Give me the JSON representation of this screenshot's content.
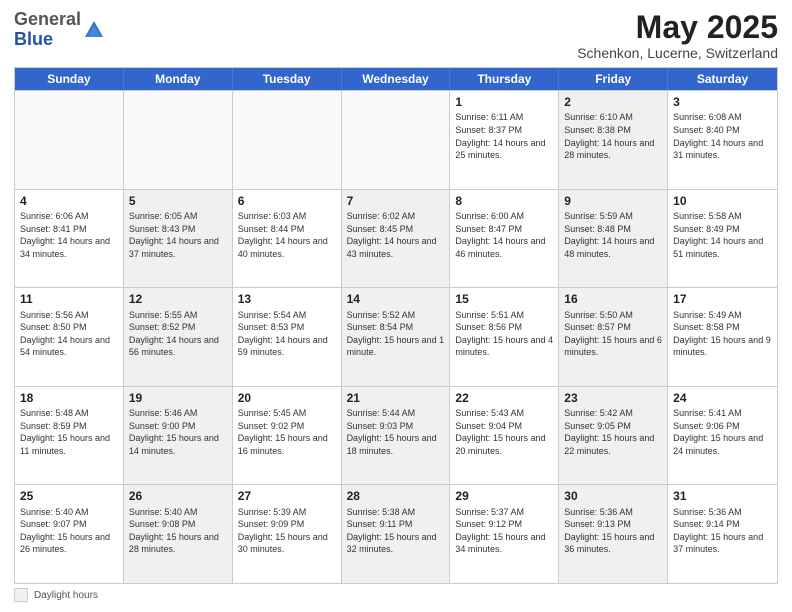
{
  "logo": {
    "general": "General",
    "blue": "Blue"
  },
  "title": "May 2025",
  "subtitle": "Schenkon, Lucerne, Switzerland",
  "weekdays": [
    "Sunday",
    "Monday",
    "Tuesday",
    "Wednesday",
    "Thursday",
    "Friday",
    "Saturday"
  ],
  "weeks": [
    [
      {
        "day": "",
        "info": "",
        "empty": true
      },
      {
        "day": "",
        "info": "",
        "empty": true
      },
      {
        "day": "",
        "info": "",
        "empty": true
      },
      {
        "day": "",
        "info": "",
        "empty": true
      },
      {
        "day": "1",
        "info": "Sunrise: 6:11 AM\nSunset: 8:37 PM\nDaylight: 14 hours and 25 minutes.",
        "empty": false,
        "shaded": false
      },
      {
        "day": "2",
        "info": "Sunrise: 6:10 AM\nSunset: 8:38 PM\nDaylight: 14 hours and 28 minutes.",
        "empty": false,
        "shaded": true
      },
      {
        "day": "3",
        "info": "Sunrise: 6:08 AM\nSunset: 8:40 PM\nDaylight: 14 hours and 31 minutes.",
        "empty": false,
        "shaded": false
      }
    ],
    [
      {
        "day": "4",
        "info": "Sunrise: 6:06 AM\nSunset: 8:41 PM\nDaylight: 14 hours and 34 minutes.",
        "empty": false,
        "shaded": false
      },
      {
        "day": "5",
        "info": "Sunrise: 6:05 AM\nSunset: 8:43 PM\nDaylight: 14 hours and 37 minutes.",
        "empty": false,
        "shaded": true
      },
      {
        "day": "6",
        "info": "Sunrise: 6:03 AM\nSunset: 8:44 PM\nDaylight: 14 hours and 40 minutes.",
        "empty": false,
        "shaded": false
      },
      {
        "day": "7",
        "info": "Sunrise: 6:02 AM\nSunset: 8:45 PM\nDaylight: 14 hours and 43 minutes.",
        "empty": false,
        "shaded": true
      },
      {
        "day": "8",
        "info": "Sunrise: 6:00 AM\nSunset: 8:47 PM\nDaylight: 14 hours and 46 minutes.",
        "empty": false,
        "shaded": false
      },
      {
        "day": "9",
        "info": "Sunrise: 5:59 AM\nSunset: 8:48 PM\nDaylight: 14 hours and 48 minutes.",
        "empty": false,
        "shaded": true
      },
      {
        "day": "10",
        "info": "Sunrise: 5:58 AM\nSunset: 8:49 PM\nDaylight: 14 hours and 51 minutes.",
        "empty": false,
        "shaded": false
      }
    ],
    [
      {
        "day": "11",
        "info": "Sunrise: 5:56 AM\nSunset: 8:50 PM\nDaylight: 14 hours and 54 minutes.",
        "empty": false,
        "shaded": false
      },
      {
        "day": "12",
        "info": "Sunrise: 5:55 AM\nSunset: 8:52 PM\nDaylight: 14 hours and 56 minutes.",
        "empty": false,
        "shaded": true
      },
      {
        "day": "13",
        "info": "Sunrise: 5:54 AM\nSunset: 8:53 PM\nDaylight: 14 hours and 59 minutes.",
        "empty": false,
        "shaded": false
      },
      {
        "day": "14",
        "info": "Sunrise: 5:52 AM\nSunset: 8:54 PM\nDaylight: 15 hours and 1 minute.",
        "empty": false,
        "shaded": true
      },
      {
        "day": "15",
        "info": "Sunrise: 5:51 AM\nSunset: 8:56 PM\nDaylight: 15 hours and 4 minutes.",
        "empty": false,
        "shaded": false
      },
      {
        "day": "16",
        "info": "Sunrise: 5:50 AM\nSunset: 8:57 PM\nDaylight: 15 hours and 6 minutes.",
        "empty": false,
        "shaded": true
      },
      {
        "day": "17",
        "info": "Sunrise: 5:49 AM\nSunset: 8:58 PM\nDaylight: 15 hours and 9 minutes.",
        "empty": false,
        "shaded": false
      }
    ],
    [
      {
        "day": "18",
        "info": "Sunrise: 5:48 AM\nSunset: 8:59 PM\nDaylight: 15 hours and 11 minutes.",
        "empty": false,
        "shaded": false
      },
      {
        "day": "19",
        "info": "Sunrise: 5:46 AM\nSunset: 9:00 PM\nDaylight: 15 hours and 14 minutes.",
        "empty": false,
        "shaded": true
      },
      {
        "day": "20",
        "info": "Sunrise: 5:45 AM\nSunset: 9:02 PM\nDaylight: 15 hours and 16 minutes.",
        "empty": false,
        "shaded": false
      },
      {
        "day": "21",
        "info": "Sunrise: 5:44 AM\nSunset: 9:03 PM\nDaylight: 15 hours and 18 minutes.",
        "empty": false,
        "shaded": true
      },
      {
        "day": "22",
        "info": "Sunrise: 5:43 AM\nSunset: 9:04 PM\nDaylight: 15 hours and 20 minutes.",
        "empty": false,
        "shaded": false
      },
      {
        "day": "23",
        "info": "Sunrise: 5:42 AM\nSunset: 9:05 PM\nDaylight: 15 hours and 22 minutes.",
        "empty": false,
        "shaded": true
      },
      {
        "day": "24",
        "info": "Sunrise: 5:41 AM\nSunset: 9:06 PM\nDaylight: 15 hours and 24 minutes.",
        "empty": false,
        "shaded": false
      }
    ],
    [
      {
        "day": "25",
        "info": "Sunrise: 5:40 AM\nSunset: 9:07 PM\nDaylight: 15 hours and 26 minutes.",
        "empty": false,
        "shaded": false
      },
      {
        "day": "26",
        "info": "Sunrise: 5:40 AM\nSunset: 9:08 PM\nDaylight: 15 hours and 28 minutes.",
        "empty": false,
        "shaded": true
      },
      {
        "day": "27",
        "info": "Sunrise: 5:39 AM\nSunset: 9:09 PM\nDaylight: 15 hours and 30 minutes.",
        "empty": false,
        "shaded": false
      },
      {
        "day": "28",
        "info": "Sunrise: 5:38 AM\nSunset: 9:11 PM\nDaylight: 15 hours and 32 minutes.",
        "empty": false,
        "shaded": true
      },
      {
        "day": "29",
        "info": "Sunrise: 5:37 AM\nSunset: 9:12 PM\nDaylight: 15 hours and 34 minutes.",
        "empty": false,
        "shaded": false
      },
      {
        "day": "30",
        "info": "Sunrise: 5:36 AM\nSunset: 9:13 PM\nDaylight: 15 hours and 36 minutes.",
        "empty": false,
        "shaded": true
      },
      {
        "day": "31",
        "info": "Sunrise: 5:36 AM\nSunset: 9:14 PM\nDaylight: 15 hours and 37 minutes.",
        "empty": false,
        "shaded": false
      }
    ]
  ],
  "footer": {
    "label": "Daylight hours"
  }
}
